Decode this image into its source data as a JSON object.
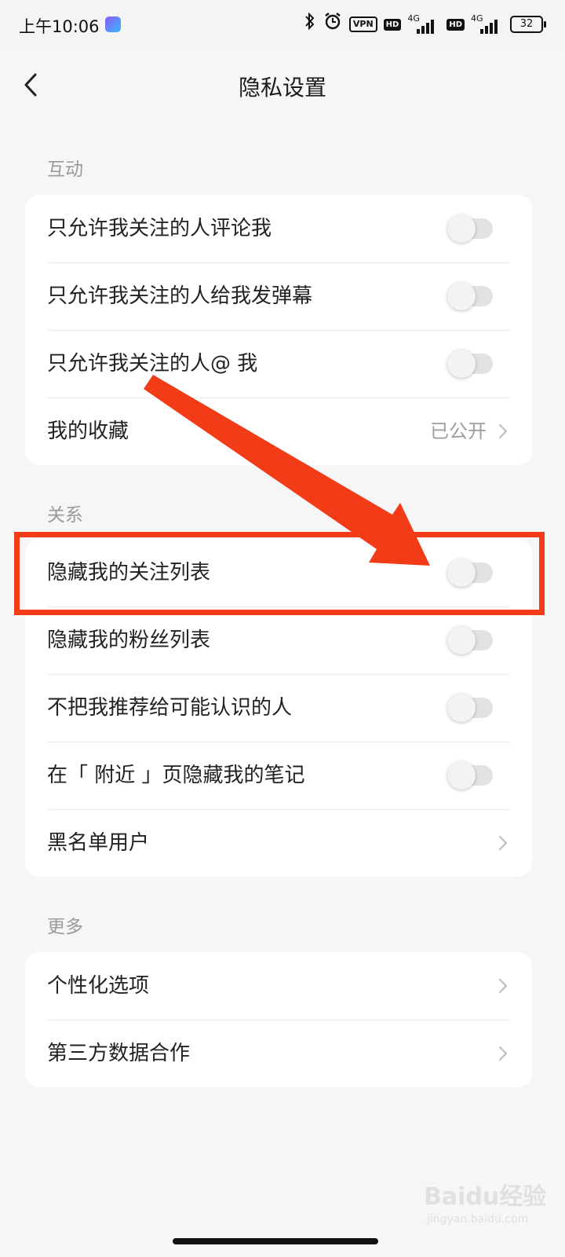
{
  "status_bar": {
    "time": "上午10:06",
    "vpn": "VPN",
    "hd1": "HD",
    "net1": "4G",
    "hd2": "HD",
    "net2": "4G",
    "battery": "32"
  },
  "header": {
    "title": "隐私设置"
  },
  "sections": {
    "interaction": {
      "label": "互动",
      "rows": [
        {
          "label": "只允许我关注的人评论我",
          "toggle_on": false
        },
        {
          "label": "只允许我关注的人给我发弹幕",
          "toggle_on": false
        },
        {
          "label": "只允许我关注的人@ 我",
          "toggle_on": false
        },
        {
          "label": "我的收藏",
          "value": "已公开"
        }
      ]
    },
    "relations": {
      "label": "关系",
      "rows": [
        {
          "label": "隐藏我的关注列表",
          "toggle_on": false
        },
        {
          "label": "隐藏我的粉丝列表",
          "toggle_on": false
        },
        {
          "label": "不把我推荐给可能认识的人",
          "toggle_on": false
        },
        {
          "label": "在「 附近 」页隐藏我的笔记",
          "toggle_on": false
        },
        {
          "label": "黑名单用户"
        }
      ]
    },
    "more": {
      "label": "更多",
      "rows": [
        {
          "label": "个性化选项"
        },
        {
          "label": "第三方数据合作"
        }
      ]
    }
  },
  "annotation": {
    "color": "#f23b17"
  },
  "watermark": {
    "text": "Baidu经验",
    "sub": "jingyan.baidu.com"
  }
}
